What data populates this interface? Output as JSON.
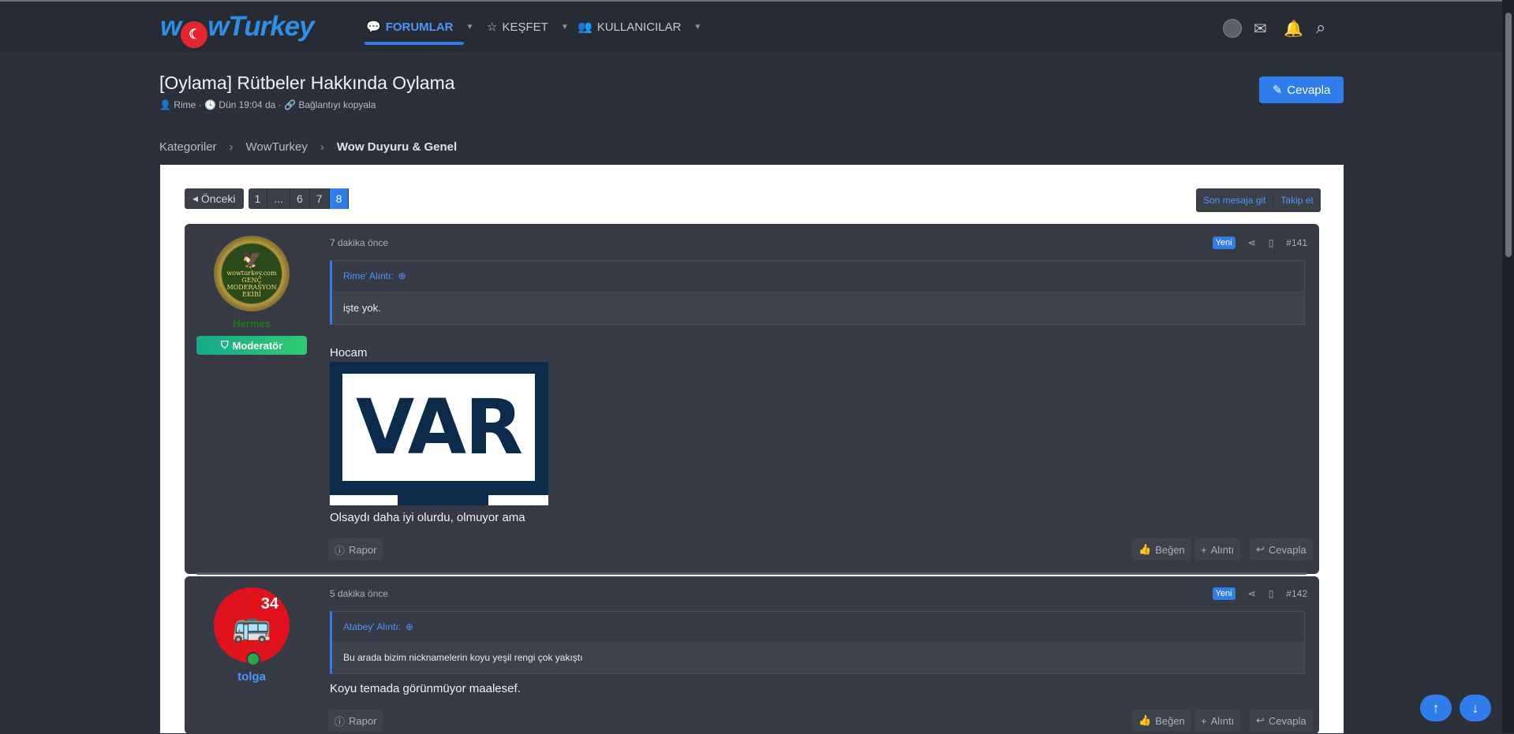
{
  "logo": {
    "text_pre": "w",
    "text_post": "wTurkey"
  },
  "nav": {
    "forums": "FORUMLAR",
    "explore": "KEŞFET",
    "users": "KULLANICILAR"
  },
  "thread": {
    "title": "[Oylama] Rütbeler Hakkında Oylama",
    "author": "Rime",
    "date": "Dün 19:04 da",
    "copy_link": "Bağlantıyı kopyala",
    "reply_button": "Cevapla"
  },
  "breadcrumb": [
    "Kategoriler",
    "WowTurkey",
    "Wow Duyuru & Genel"
  ],
  "pagination": {
    "prev": "Önceki",
    "pages": [
      "1",
      "...",
      "6",
      "7",
      "8"
    ],
    "current": "8"
  },
  "follow": {
    "last_post": "Son mesaja git",
    "follow": "Takip et"
  },
  "posts": [
    {
      "avatar_text": [
        "wowturkey.com",
        "GENÇ",
        "MODERASYON",
        "EKİBİ"
      ],
      "username": "Hermes",
      "badge": "Moderatör",
      "time": "7 dakika önce",
      "new_label": "Yeni",
      "number": "#141",
      "quote_author": "Rime' Alıntı:",
      "quote_text": "işte yok.",
      "text1": "Hocam",
      "image_text": "VAR",
      "text2": "Olsaydı daha iyi olurdu, olmuyor ama",
      "actions": {
        "report": "Rapor",
        "like": "Beğen",
        "quote": "Alıntı",
        "reply": "Cevapla"
      }
    },
    {
      "avatar_number": "34",
      "username": "tolga",
      "time": "5 dakika önce",
      "new_label": "Yeni",
      "number": "#142",
      "quote_author": "Atabey' Alıntı:",
      "quote_text": "Bu arada bizim nicknamelerin koyu yeşil rengi çok yakıştı",
      "text1": "Koyu temada görünmüyor maalesef.",
      "actions": {
        "report": "Rapor",
        "like": "Beğen",
        "quote": "Alıntı",
        "reply": "Cevapla"
      }
    }
  ],
  "colors": {
    "accent": "#2f7dea",
    "background": "#2b303b",
    "post": "#353a44"
  }
}
